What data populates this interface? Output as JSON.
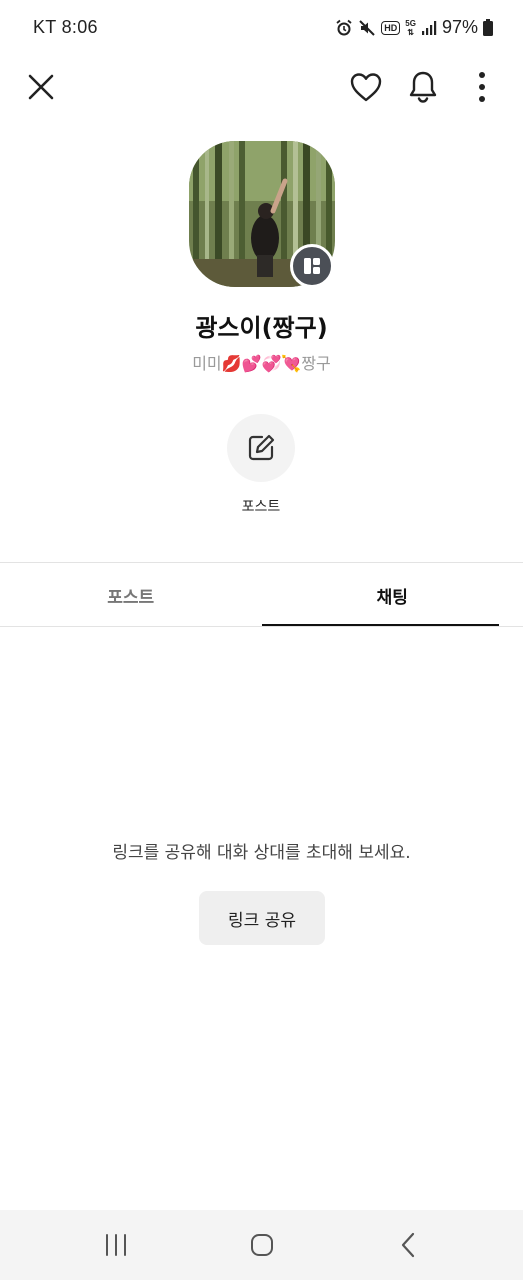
{
  "status_bar": {
    "carrier_time": "KT 8:06",
    "hd_label": "HD",
    "network_label": "5G",
    "battery_text": "97%",
    "icons": [
      "alarm-icon",
      "mute-icon",
      "hd-icon",
      "5g-icon",
      "signal-icon",
      "battery-icon"
    ]
  },
  "top_bar": {
    "icons": [
      "close-icon",
      "heart-icon",
      "bell-icon",
      "more-vertical-icon"
    ]
  },
  "profile": {
    "name": "광스이(짱구)",
    "status_message": "미미💋💕💞💘짱구",
    "badge_icon": "profile-layout-icon"
  },
  "post_action": {
    "label": "포스트",
    "icon": "edit-icon"
  },
  "tabs": [
    {
      "label": "포스트",
      "selected": false
    },
    {
      "label": "채팅",
      "selected": true
    }
  ],
  "empty_state": {
    "message": "링크를 공유해 대화 상대를 초대해 보세요.",
    "share_button_label": "링크 공유"
  },
  "nav_bar": {
    "icons": [
      "recents-icon",
      "home-icon",
      "back-icon"
    ]
  },
  "colors": {
    "badge": "#4b4f56",
    "tab_underline": "#111111",
    "share_button_bg": "#efefef",
    "post_circle_bg": "#f3f3f3"
  }
}
